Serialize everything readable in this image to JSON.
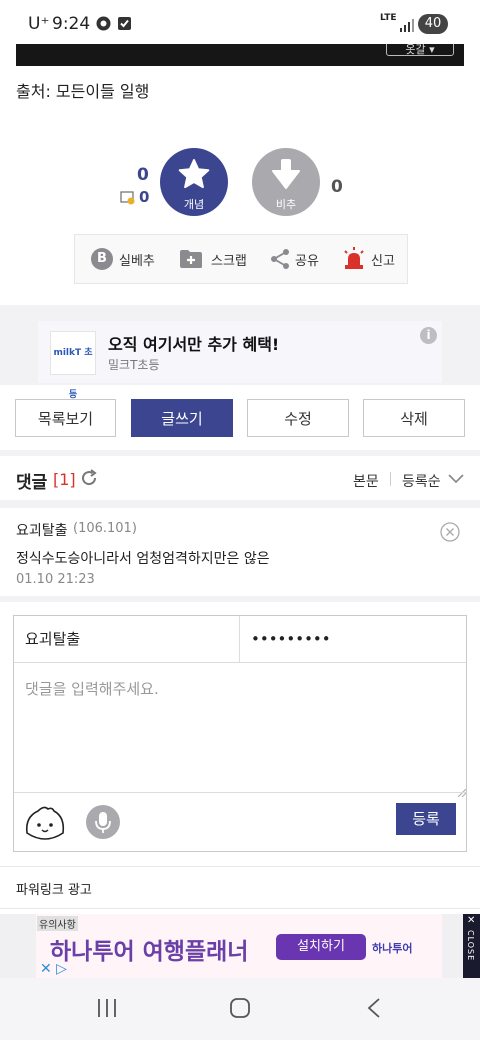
{
  "status_bar": {
    "carrier": "U⁺",
    "time": "9:24",
    "network": "LTE",
    "battery": "40"
  },
  "video": {
    "select_label": "옷갈 ▾"
  },
  "source_text": "출처: 모든이들 일행",
  "votes": {
    "up_count": "0",
    "sub_count": "0",
    "up_label": "개념",
    "down_label": "비추",
    "down_count": "0"
  },
  "actions": [
    {
      "label": "실베추",
      "icon": "b-badge-icon"
    },
    {
      "label": "스크랩",
      "icon": "folder-plus-icon"
    },
    {
      "label": "공유",
      "icon": "share-icon"
    },
    {
      "label": "신고",
      "icon": "siren-icon"
    }
  ],
  "promo": {
    "logo": "milkT 초등",
    "title": "오직 여기서만 추가 혜택!",
    "subtitle": "밀크T초등"
  },
  "buttons": {
    "list": "목록보기",
    "write": "글쓰기",
    "edit": "수정",
    "delete": "삭제"
  },
  "comments": {
    "heading": "댓글",
    "count": "[1]",
    "sort_body": "본문",
    "sort_order": "등록순",
    "items": [
      {
        "nick": "요괴탈출",
        "ip": "(106.101)",
        "text": "정식수도승아니라서 엄청엄격하지만은 않은",
        "time": "01.10 21:23"
      }
    ]
  },
  "comment_form": {
    "nickname": "요괴탈출",
    "password": "•••••••••",
    "placeholder": "댓글을 입력해주세요.",
    "submit": "등록"
  },
  "powerlink": "파워링크 광고",
  "ad": {
    "notice": "유의사항",
    "title": "하나투어 여행플래너",
    "install": "설치하기",
    "brand": "하나투어",
    "close": "CLOSE"
  },
  "colors": {
    "accent": "#3b4590",
    "down": "#a9a9ae",
    "alert": "#d9322b"
  }
}
